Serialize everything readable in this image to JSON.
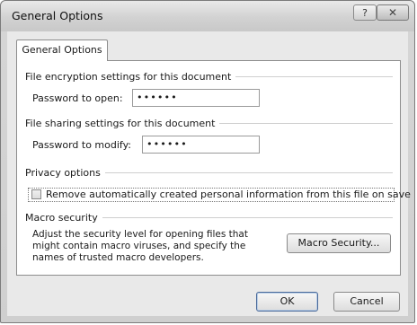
{
  "window": {
    "title": "General Options",
    "help_glyph": "?",
    "close_glyph": "✕"
  },
  "tab": {
    "label": "General Options"
  },
  "encryption": {
    "heading": "File encryption settings for this document",
    "open_label": "Password to open:",
    "open_value": "••••••"
  },
  "sharing": {
    "heading": "File sharing settings for this document",
    "modify_label": "Password to modify:",
    "modify_value": "••••••"
  },
  "privacy": {
    "heading": "Privacy options",
    "remove_info_label": "Remove automatically created personal information from this file on save",
    "remove_info_checked": false
  },
  "macro": {
    "heading": "Macro security",
    "description": "Adjust the security level for opening files that might contain macro viruses, and specify the names of trusted macro developers.",
    "button_label": "Macro Security..."
  },
  "footer": {
    "ok_label": "OK",
    "cancel_label": "Cancel"
  }
}
